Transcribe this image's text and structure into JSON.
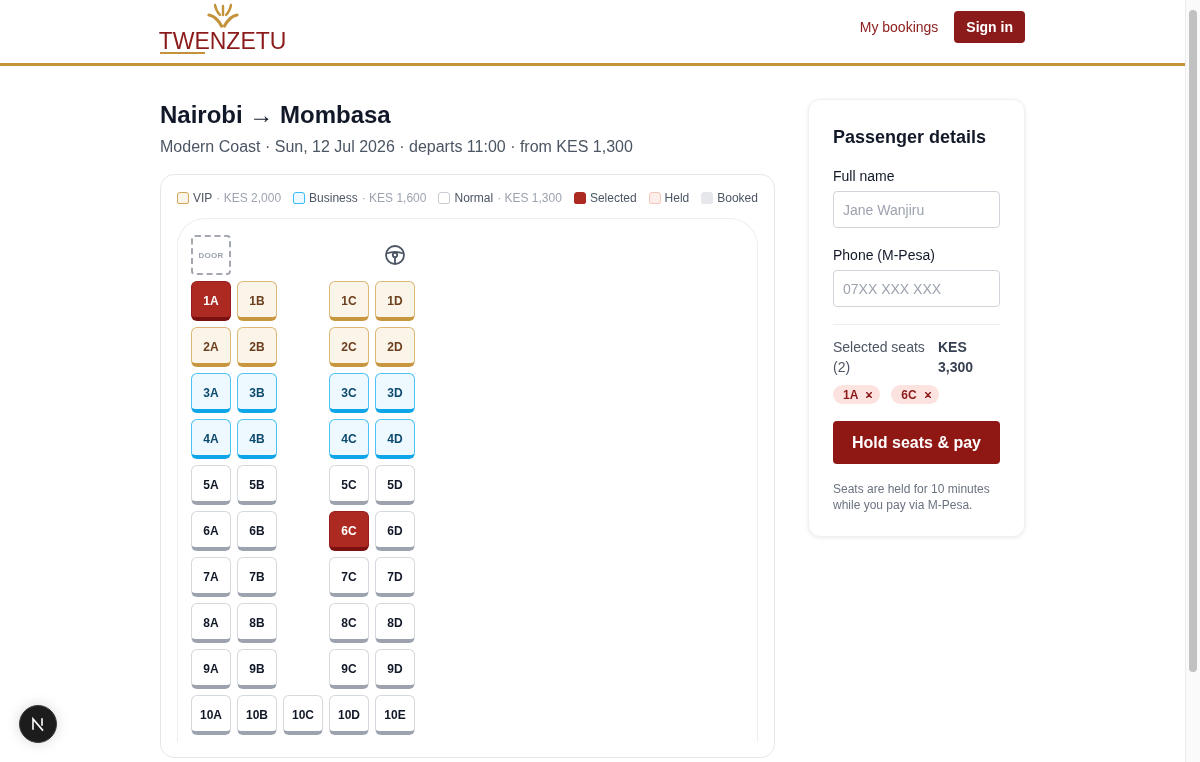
{
  "header": {
    "logo": {
      "wordmark": "TWENZETU"
    },
    "nav": [
      {
        "kind": "link",
        "label": "My bookings"
      },
      {
        "kind": "button",
        "label": "Sign in"
      }
    ]
  },
  "trip": {
    "title": "Nairobi → Mombasa",
    "subtitle": "Modern Coast · Sun, 12 Jul 2026 · departs 11:00 · from KES 1,300"
  },
  "seat_map": {
    "legend": [
      {
        "kind": "vip",
        "label": "VIP",
        "price": "· KES 2,000"
      },
      {
        "kind": "business",
        "label": "Business",
        "price": "· KES 1,600"
      },
      {
        "kind": "normal",
        "label": "Normal",
        "price": "· KES 1,300"
      },
      {
        "kind": "selected",
        "label": "Selected"
      },
      {
        "kind": "held",
        "label": "Held"
      },
      {
        "kind": "booked",
        "label": "Booked"
      }
    ],
    "door": "DOOR",
    "rows": [
      {
        "seats": [
          {
            "label": "1A",
            "kind": "vip",
            "selected": true
          },
          {
            "label": "1B",
            "kind": "vip",
            "selected": false
          },
          {
            "label": "1C",
            "kind": "vip",
            "selected": false
          },
          {
            "label": "1D",
            "kind": "vip",
            "selected": false
          }
        ]
      },
      {
        "seats": [
          {
            "label": "2A",
            "kind": "vip",
            "selected": false
          },
          {
            "label": "2B",
            "kind": "vip",
            "selected": false
          },
          {
            "label": "2C",
            "kind": "vip",
            "selected": false
          },
          {
            "label": "2D",
            "kind": "vip",
            "selected": false
          }
        ]
      },
      {
        "seats": [
          {
            "label": "3A",
            "kind": "business",
            "selected": false
          },
          {
            "label": "3B",
            "kind": "business",
            "selected": false
          },
          {
            "label": "3C",
            "kind": "business",
            "selected": false
          },
          {
            "label": "3D",
            "kind": "business",
            "selected": false
          }
        ]
      },
      {
        "seats": [
          {
            "label": "4A",
            "kind": "business",
            "selected": false
          },
          {
            "label": "4B",
            "kind": "business",
            "selected": false
          },
          {
            "label": "4C",
            "kind": "business",
            "selected": false
          },
          {
            "label": "4D",
            "kind": "business",
            "selected": false
          }
        ]
      },
      {
        "seats": [
          {
            "label": "5A",
            "kind": "normal",
            "selected": false
          },
          {
            "label": "5B",
            "kind": "normal",
            "selected": false
          },
          {
            "label": "5C",
            "kind": "normal",
            "selected": false
          },
          {
            "label": "5D",
            "kind": "normal",
            "selected": false
          }
        ]
      },
      {
        "seats": [
          {
            "label": "6A",
            "kind": "normal",
            "selected": false
          },
          {
            "label": "6B",
            "kind": "normal",
            "selected": false
          },
          {
            "label": "6C",
            "kind": "normal",
            "selected": true
          },
          {
            "label": "6D",
            "kind": "normal",
            "selected": false
          }
        ]
      },
      {
        "seats": [
          {
            "label": "7A",
            "kind": "normal",
            "selected": false
          },
          {
            "label": "7B",
            "kind": "normal",
            "selected": false
          },
          {
            "label": "7C",
            "kind": "normal",
            "selected": false
          },
          {
            "label": "7D",
            "kind": "normal",
            "selected": false
          }
        ]
      },
      {
        "seats": [
          {
            "label": "8A",
            "kind": "normal",
            "selected": false
          },
          {
            "label": "8B",
            "kind": "normal",
            "selected": false
          },
          {
            "label": "8C",
            "kind": "normal",
            "selected": false
          },
          {
            "label": "8D",
            "kind": "normal",
            "selected": false
          }
        ]
      },
      {
        "seats": [
          {
            "label": "9A",
            "kind": "normal",
            "selected": false
          },
          {
            "label": "9B",
            "kind": "normal",
            "selected": false
          },
          {
            "label": "9C",
            "kind": "normal",
            "selected": false
          },
          {
            "label": "9D",
            "kind": "normal",
            "selected": false
          }
        ]
      },
      {
        "seats": [
          {
            "label": "10A",
            "kind": "normal",
            "selected": false
          },
          {
            "label": "10B",
            "kind": "normal",
            "selected": false
          },
          {
            "label": "10C",
            "kind": "normal",
            "selected": false
          },
          {
            "label": "10D",
            "kind": "normal",
            "selected": false
          },
          {
            "label": "10E",
            "kind": "normal",
            "selected": false
          }
        ]
      }
    ]
  },
  "passenger_panel": {
    "title": "Passenger details",
    "fields": [
      {
        "label": "Full name",
        "placeholder": "Jane Wanjiru"
      },
      {
        "label": "Phone (M-Pesa)",
        "placeholder": "07XX XXX XXX"
      }
    ],
    "summary": {
      "label": "Selected seats (2)",
      "total": "KES 3,300",
      "chips": [
        {
          "label": "1A"
        },
        {
          "label": "6C"
        }
      ]
    },
    "button": "Hold seats & pay",
    "note": "Seats are held for 10 minutes while you pay via M-Pesa."
  }
}
